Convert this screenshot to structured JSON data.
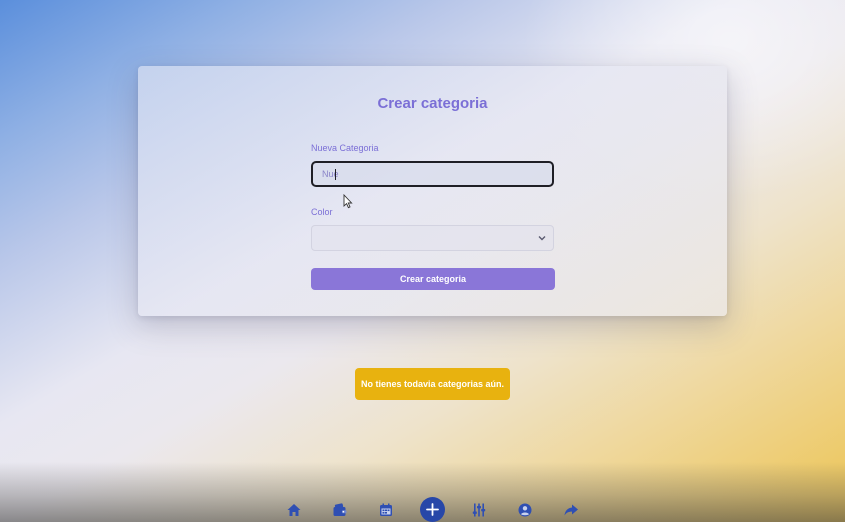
{
  "form": {
    "title": "Crear categoria",
    "name_label": "Nueva Categoria",
    "name_value": "Nue",
    "color_label": "Color",
    "color_selected": "",
    "submit_label": "Crear categoria"
  },
  "alert": {
    "text": "No tienes todavia categorias aún."
  },
  "nav": {
    "items": [
      {
        "icon": "home-icon"
      },
      {
        "icon": "wallet-icon"
      },
      {
        "icon": "calendar-icon"
      },
      {
        "icon": "plus-icon"
      },
      {
        "icon": "sliders-icon"
      },
      {
        "icon": "user-circle-icon"
      },
      {
        "icon": "share-icon"
      }
    ]
  },
  "colors": {
    "accent": "#7b6fd6",
    "button": "#8a76d8",
    "alert": "#e8b20f",
    "nav_add": "#2747a8"
  }
}
